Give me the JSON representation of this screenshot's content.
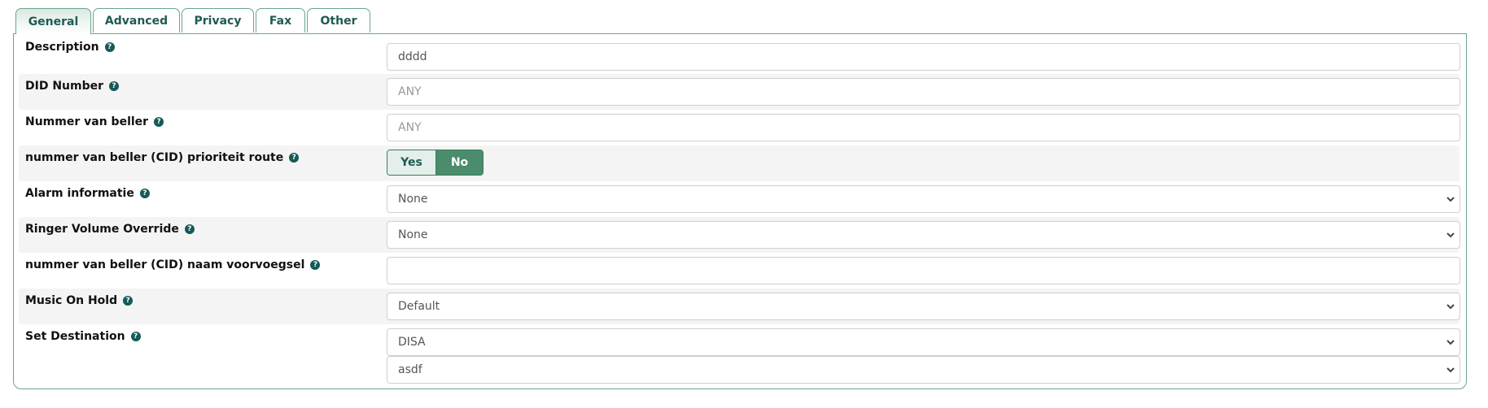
{
  "tabs": [
    {
      "label": "General",
      "active": true
    },
    {
      "label": "Advanced",
      "active": false
    },
    {
      "label": "Privacy",
      "active": false
    },
    {
      "label": "Fax",
      "active": false
    },
    {
      "label": "Other",
      "active": false
    }
  ],
  "form": {
    "description": {
      "label": "Description",
      "value": "dddd"
    },
    "did_number": {
      "label": "DID Number",
      "placeholder": "ANY"
    },
    "caller_number": {
      "label": "Nummer van beller",
      "placeholder": "ANY"
    },
    "cid_priority": {
      "label": "nummer van beller (CID) prioriteit route",
      "yes_label": "Yes",
      "no_label": "No",
      "selected": "No"
    },
    "alert_info": {
      "label": "Alarm informatie",
      "selected": "None"
    },
    "ringer_volume": {
      "label": "Ringer Volume Override",
      "selected": "None"
    },
    "cid_name_prefix": {
      "label": "nummer van beller (CID) naam voorvoegsel",
      "value": ""
    },
    "music_on_hold": {
      "label": "Music On Hold",
      "selected": "Default"
    },
    "set_destination": {
      "label": "Set Destination",
      "type_selected": "DISA",
      "target_selected": "asdf"
    }
  },
  "icons": {
    "help": "question-circle-icon",
    "select": "chevron-down-icon"
  },
  "colors": {
    "accent": "#4a8c6c",
    "border": "#6aa68a",
    "text_dark": "#1e5b52"
  }
}
